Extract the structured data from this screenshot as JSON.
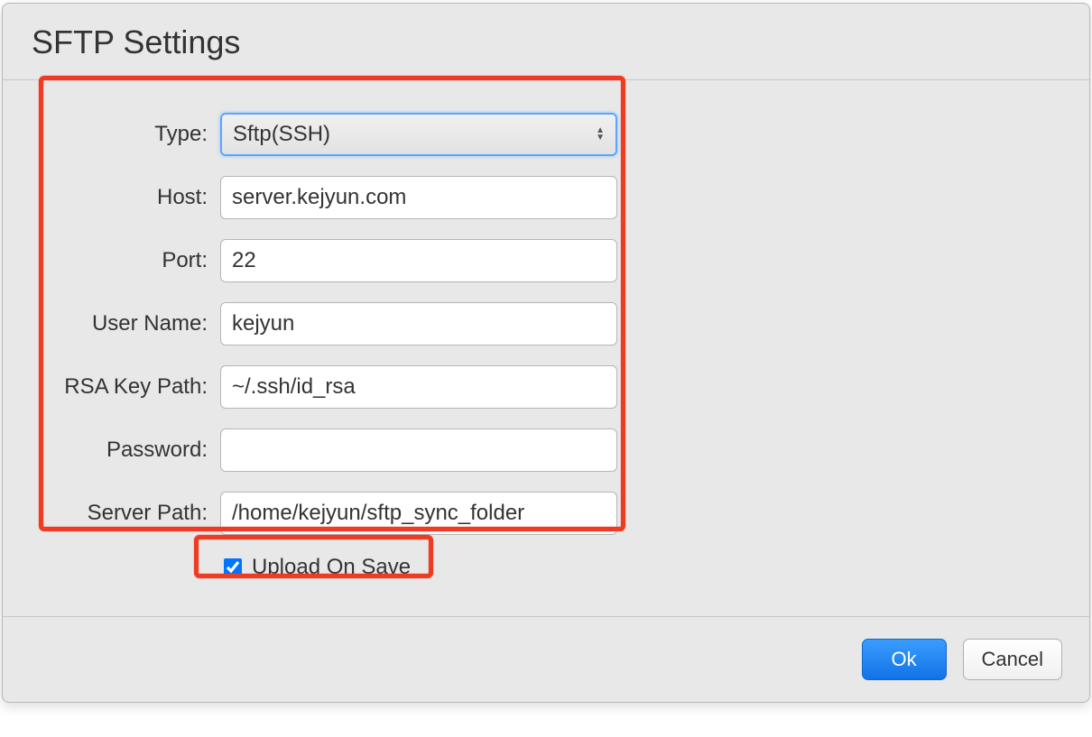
{
  "dialog": {
    "title": "SFTP Settings"
  },
  "form": {
    "type": {
      "label": "Type:",
      "value": "Sftp(SSH)"
    },
    "host": {
      "label": "Host:",
      "value": "server.kejyun.com"
    },
    "port": {
      "label": "Port:",
      "value": "22"
    },
    "user": {
      "label": "User Name:",
      "value": "kejyun"
    },
    "rsa": {
      "label": "RSA Key Path:",
      "value": "~/.ssh/id_rsa"
    },
    "password": {
      "label": "Password:",
      "value": ""
    },
    "server_path": {
      "label": "Server Path:",
      "value": "/home/kejyun/sftp_sync_folder"
    },
    "upload_on_save": {
      "label": "Upload On Save",
      "checked": true
    }
  },
  "buttons": {
    "ok": "Ok",
    "cancel": "Cancel"
  }
}
